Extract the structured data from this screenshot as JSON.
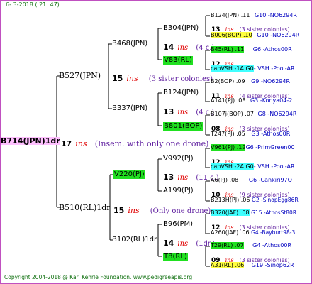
{
  "header": "6- 3-2018 ( 21: 47)",
  "footer": "Copyright 2004-2018 @ Karl Kehrle Foundation.   www.pedigreeapis.org",
  "root": {
    "name": "B714(JPN)1dr",
    "num": "17",
    "ins": "ins",
    "note": "(Insem. with only one drone)"
  },
  "gen1": [
    {
      "name": "B527(JPN)",
      "num": "15",
      "ins": "ins",
      "note": "(3 sister colonies)"
    },
    {
      "name": "B510(RL)1dr",
      "num": "15",
      "ins": "ins",
      "note": "(Only one drone)"
    }
  ],
  "gen2": [
    {
      "name": "B468(JPN)",
      "num": "14",
      "ins": "ins",
      "note": "(4 c.)"
    },
    {
      "name": "B337(JPN)",
      "num": "13",
      "ins": "ins",
      "note": "(4 c.)"
    },
    {
      "name": "V220(PJ)",
      "num": "13",
      "ins": "ins",
      "note": "(11 c.)"
    },
    {
      "name": "B102(RL)1dr",
      "num": "14",
      "ins": "ins",
      "note": "(1dr.)"
    }
  ],
  "gen3": [
    {
      "name": "B304(JPN)"
    },
    {
      "name": "V83(RL)"
    },
    {
      "name": "B124(JPN)"
    },
    {
      "name": "B801(BOP)"
    },
    {
      "name": "V992(PJ)"
    },
    {
      "name": "A199(PJ)"
    },
    {
      "name": "B96(PM)"
    },
    {
      "name": "T8(RL)"
    }
  ],
  "gen4": [
    {
      "top": "B124(JPN) .11",
      "topcode": "G10 -NO6294R",
      "num": "13",
      "ins": "ins",
      "note": "(3 sister colonies)",
      "bot": "B006(BOP) .10",
      "botcode": "G10 -NO6294R"
    },
    {
      "top": "B45(RL) .11",
      "topcode": "G6 -Athos00R",
      "num": "12",
      "ins": "ins",
      "note": "",
      "bot": "capVSH -1A G0",
      "botcode": "- VSH -Pool-AR"
    },
    {
      "top": "B2(BOP) .09",
      "topcode": "G9 -NO6294R",
      "num": "11",
      "ins": "ins",
      "note": "(4 sister colonies)",
      "bot": "A141(PJ) .08",
      "botcode": "G3 -Konya04-2"
    },
    {
      "top": "B107j(BOP) .07",
      "topcode": "G8 -NO6294R",
      "num": "08",
      "ins": "ins",
      "note": "(3 sister colonies)",
      "bot": "T247(PJ) .05",
      "botcode": "G3 -Athos00R"
    },
    {
      "top": "V961(PJ) .12",
      "topcode": "G6 -PrimGreen00",
      "num": "12",
      "ins": "ins",
      "note": "",
      "bot": "capVSH -2A G0",
      "botcode": "- VSH -Pool-AR"
    },
    {
      "top": "A6(PJ) .08",
      "topcode": "G6 -Cankiri97Q",
      "num": "10",
      "ins": "ins",
      "note": "(9 sister colonies)",
      "bot": "B213H(PJ) .06",
      "botcode": "G2 -SinopEgg86R"
    },
    {
      "top": "B320(JAF) .08",
      "topcode": "G15 -AthosSt80R",
      "num": "12",
      "ins": "ins",
      "note": "(3 sister colonies)",
      "bot": "A260(JAF) .06",
      "botcode": "G4 -Bayburt98-3"
    },
    {
      "top": "T29(RL) .07",
      "topcode": "G4 -Athos00R",
      "num": "09",
      "ins": "ins",
      "note": "(3 sister colonies)",
      "bot": "A31(RL) .06",
      "botcode": "G19 -Sinop62R"
    }
  ]
}
